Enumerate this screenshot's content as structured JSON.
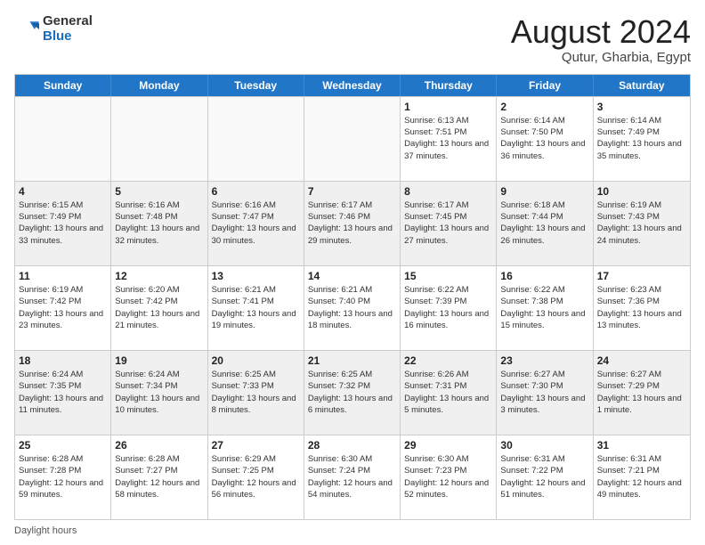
{
  "header": {
    "logo_general": "General",
    "logo_blue": "Blue",
    "title": "August 2024",
    "location": "Qutur, Gharbia, Egypt"
  },
  "footer": {
    "label": "Daylight hours"
  },
  "calendar": {
    "headers": [
      "Sunday",
      "Monday",
      "Tuesday",
      "Wednesday",
      "Thursday",
      "Friday",
      "Saturday"
    ],
    "rows": [
      [
        {
          "day": "",
          "info": "",
          "empty": true
        },
        {
          "day": "",
          "info": "",
          "empty": true
        },
        {
          "day": "",
          "info": "",
          "empty": true
        },
        {
          "day": "",
          "info": "",
          "empty": true
        },
        {
          "day": "1",
          "info": "Sunrise: 6:13 AM\nSunset: 7:51 PM\nDaylight: 13 hours and 37 minutes.",
          "empty": false
        },
        {
          "day": "2",
          "info": "Sunrise: 6:14 AM\nSunset: 7:50 PM\nDaylight: 13 hours and 36 minutes.",
          "empty": false
        },
        {
          "day": "3",
          "info": "Sunrise: 6:14 AM\nSunset: 7:49 PM\nDaylight: 13 hours and 35 minutes.",
          "empty": false
        }
      ],
      [
        {
          "day": "4",
          "info": "Sunrise: 6:15 AM\nSunset: 7:49 PM\nDaylight: 13 hours and 33 minutes.",
          "empty": false
        },
        {
          "day": "5",
          "info": "Sunrise: 6:16 AM\nSunset: 7:48 PM\nDaylight: 13 hours and 32 minutes.",
          "empty": false
        },
        {
          "day": "6",
          "info": "Sunrise: 6:16 AM\nSunset: 7:47 PM\nDaylight: 13 hours and 30 minutes.",
          "empty": false
        },
        {
          "day": "7",
          "info": "Sunrise: 6:17 AM\nSunset: 7:46 PM\nDaylight: 13 hours and 29 minutes.",
          "empty": false
        },
        {
          "day": "8",
          "info": "Sunrise: 6:17 AM\nSunset: 7:45 PM\nDaylight: 13 hours and 27 minutes.",
          "empty": false
        },
        {
          "day": "9",
          "info": "Sunrise: 6:18 AM\nSunset: 7:44 PM\nDaylight: 13 hours and 26 minutes.",
          "empty": false
        },
        {
          "day": "10",
          "info": "Sunrise: 6:19 AM\nSunset: 7:43 PM\nDaylight: 13 hours and 24 minutes.",
          "empty": false
        }
      ],
      [
        {
          "day": "11",
          "info": "Sunrise: 6:19 AM\nSunset: 7:42 PM\nDaylight: 13 hours and 23 minutes.",
          "empty": false
        },
        {
          "day": "12",
          "info": "Sunrise: 6:20 AM\nSunset: 7:42 PM\nDaylight: 13 hours and 21 minutes.",
          "empty": false
        },
        {
          "day": "13",
          "info": "Sunrise: 6:21 AM\nSunset: 7:41 PM\nDaylight: 13 hours and 19 minutes.",
          "empty": false
        },
        {
          "day": "14",
          "info": "Sunrise: 6:21 AM\nSunset: 7:40 PM\nDaylight: 13 hours and 18 minutes.",
          "empty": false
        },
        {
          "day": "15",
          "info": "Sunrise: 6:22 AM\nSunset: 7:39 PM\nDaylight: 13 hours and 16 minutes.",
          "empty": false
        },
        {
          "day": "16",
          "info": "Sunrise: 6:22 AM\nSunset: 7:38 PM\nDaylight: 13 hours and 15 minutes.",
          "empty": false
        },
        {
          "day": "17",
          "info": "Sunrise: 6:23 AM\nSunset: 7:36 PM\nDaylight: 13 hours and 13 minutes.",
          "empty": false
        }
      ],
      [
        {
          "day": "18",
          "info": "Sunrise: 6:24 AM\nSunset: 7:35 PM\nDaylight: 13 hours and 11 minutes.",
          "empty": false
        },
        {
          "day": "19",
          "info": "Sunrise: 6:24 AM\nSunset: 7:34 PM\nDaylight: 13 hours and 10 minutes.",
          "empty": false
        },
        {
          "day": "20",
          "info": "Sunrise: 6:25 AM\nSunset: 7:33 PM\nDaylight: 13 hours and 8 minutes.",
          "empty": false
        },
        {
          "day": "21",
          "info": "Sunrise: 6:25 AM\nSunset: 7:32 PM\nDaylight: 13 hours and 6 minutes.",
          "empty": false
        },
        {
          "day": "22",
          "info": "Sunrise: 6:26 AM\nSunset: 7:31 PM\nDaylight: 13 hours and 5 minutes.",
          "empty": false
        },
        {
          "day": "23",
          "info": "Sunrise: 6:27 AM\nSunset: 7:30 PM\nDaylight: 13 hours and 3 minutes.",
          "empty": false
        },
        {
          "day": "24",
          "info": "Sunrise: 6:27 AM\nSunset: 7:29 PM\nDaylight: 13 hours and 1 minute.",
          "empty": false
        }
      ],
      [
        {
          "day": "25",
          "info": "Sunrise: 6:28 AM\nSunset: 7:28 PM\nDaylight: 12 hours and 59 minutes.",
          "empty": false
        },
        {
          "day": "26",
          "info": "Sunrise: 6:28 AM\nSunset: 7:27 PM\nDaylight: 12 hours and 58 minutes.",
          "empty": false
        },
        {
          "day": "27",
          "info": "Sunrise: 6:29 AM\nSunset: 7:25 PM\nDaylight: 12 hours and 56 minutes.",
          "empty": false
        },
        {
          "day": "28",
          "info": "Sunrise: 6:30 AM\nSunset: 7:24 PM\nDaylight: 12 hours and 54 minutes.",
          "empty": false
        },
        {
          "day": "29",
          "info": "Sunrise: 6:30 AM\nSunset: 7:23 PM\nDaylight: 12 hours and 52 minutes.",
          "empty": false
        },
        {
          "day": "30",
          "info": "Sunrise: 6:31 AM\nSunset: 7:22 PM\nDaylight: 12 hours and 51 minutes.",
          "empty": false
        },
        {
          "day": "31",
          "info": "Sunrise: 6:31 AM\nSunset: 7:21 PM\nDaylight: 12 hours and 49 minutes.",
          "empty": false
        }
      ]
    ]
  }
}
